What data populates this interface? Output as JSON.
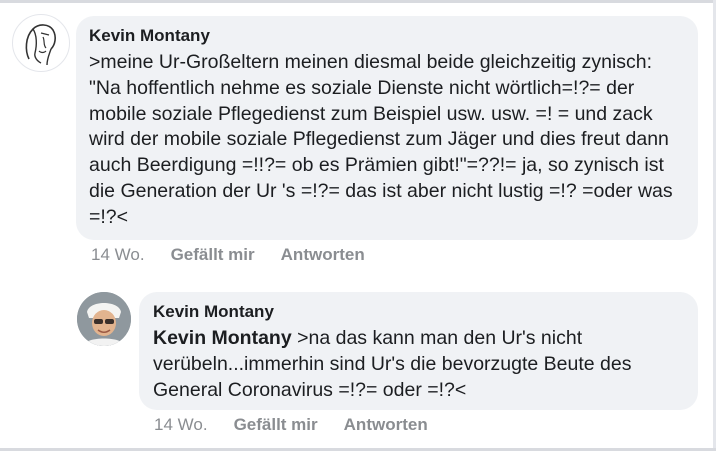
{
  "comments": [
    {
      "author": "Kevin Montany",
      "text": ">meine Ur-Großeltern meinen diesmal beide gleichzeitig zynisch: \"Na hoffentlich nehme es soziale Dienste nicht wörtlich=!?= der mobile soziale Pflegedienst zum Beispiel usw. usw. =! = und zack wird der mobile soziale Pflegedienst zum Jäger und dies freut dann auch Beerdigung =!!?= ob es Prämien gibt!\"=??!= ja, so zynisch ist die Generation der Ur 's =!?= das ist aber nicht lustig =!? =oder was =!?<",
      "time": "14 Wo.",
      "like_label": "Gefällt mir",
      "reply_label": "Antworten"
    },
    {
      "author": "Kevin Montany",
      "mention": "Kevin Montany",
      "text": " >na das kann man den Ur's nicht verübeln...immerhin sind Ur's die bevorzugte Beute des General Coronavirus  =!?= oder =!?<",
      "time": "14 Wo.",
      "like_label": "Gefällt mir",
      "reply_label": "Antworten"
    }
  ],
  "colors": {
    "bubble_bg": "#f0f2f5",
    "meta_text": "#8a8d91",
    "text": "#1c1e21"
  }
}
